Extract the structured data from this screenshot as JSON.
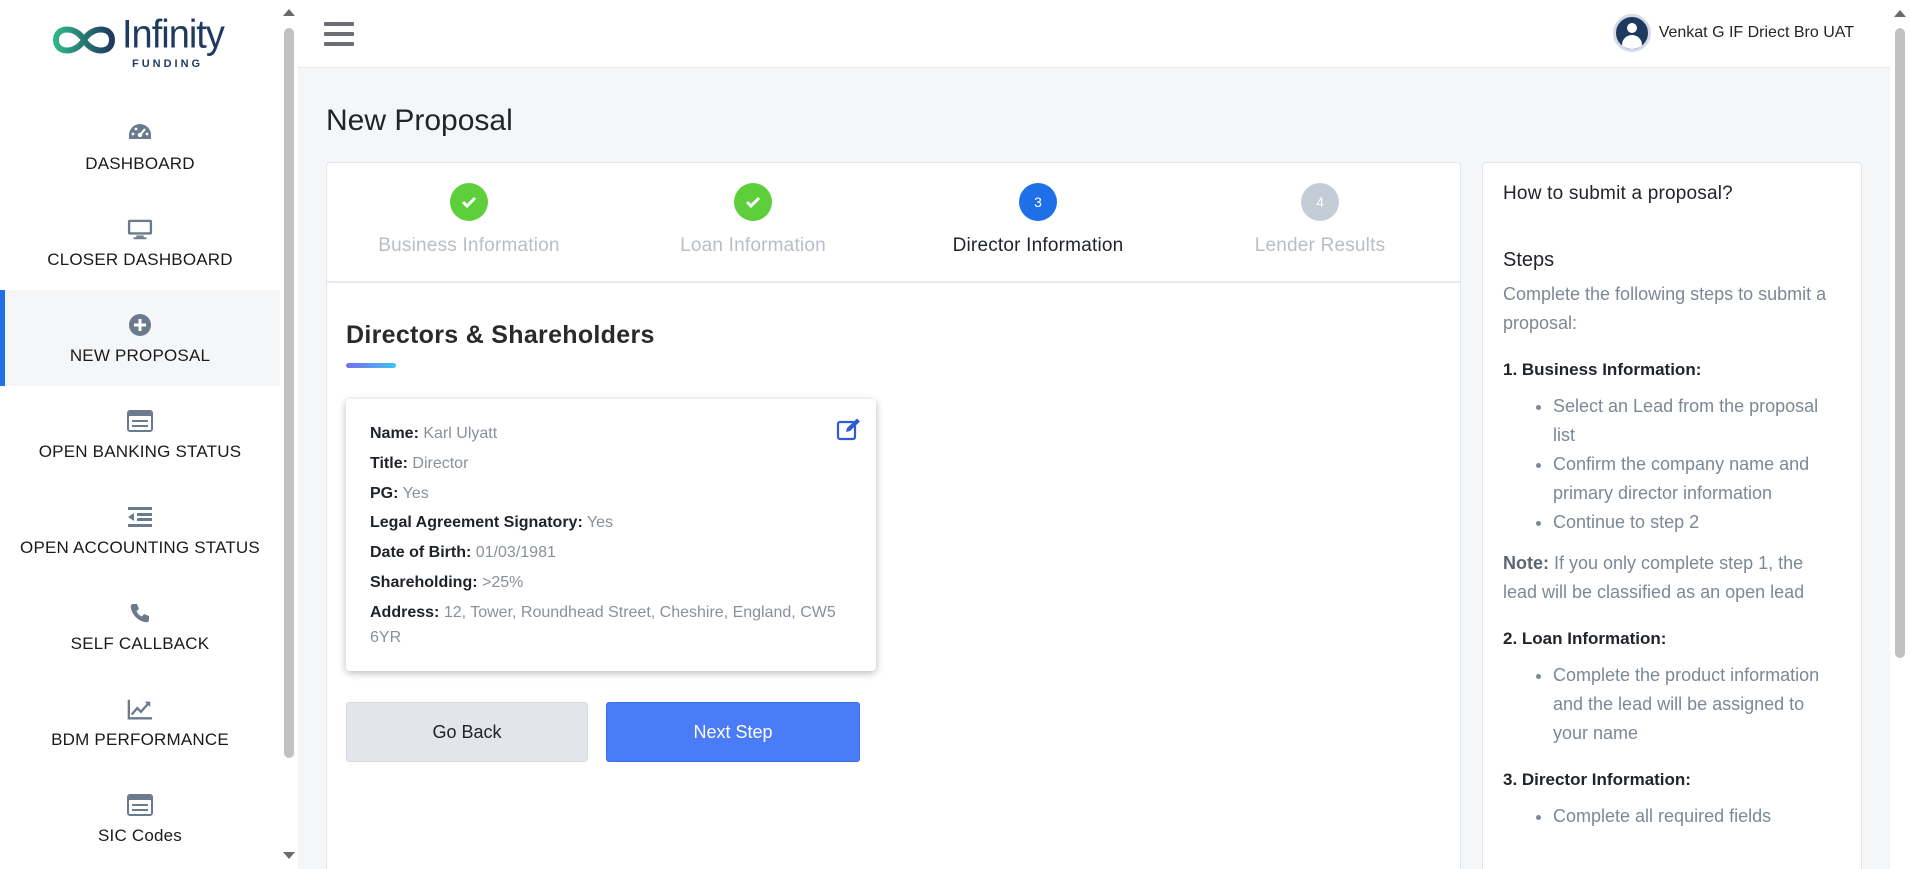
{
  "brand": {
    "name": "Infinity",
    "sub": "FUNDING"
  },
  "sidebar": {
    "items": [
      {
        "label": "DASHBOARD",
        "icon": "dashboard-gauge-icon"
      },
      {
        "label": "CLOSER DASHBOARD",
        "icon": "monitor-icon"
      },
      {
        "label": "NEW PROPOSAL",
        "icon": "plus-circle-icon",
        "active": true
      },
      {
        "label": "OPEN BANKING STATUS",
        "icon": "browser-window-icon"
      },
      {
        "label": "OPEN ACCOUNTING STATUS",
        "icon": "indent-list-icon"
      },
      {
        "label": "SELF CALLBACK",
        "icon": "phone-icon"
      },
      {
        "label": "BDM PERFORMANCE",
        "icon": "line-chart-icon"
      },
      {
        "label": "SIC Codes",
        "icon": "browser-window-icon"
      }
    ]
  },
  "topbar": {
    "user_name": "Venkat G IF Driect Bro UAT"
  },
  "page": {
    "title": "New Proposal"
  },
  "stepper": {
    "steps": [
      {
        "label": "Business Information",
        "state": "done",
        "number": "1"
      },
      {
        "label": "Loan Information",
        "state": "done",
        "number": "2"
      },
      {
        "label": "Director Information",
        "state": "current",
        "number": "3"
      },
      {
        "label": "Lender Results",
        "state": "pending",
        "number": "4"
      }
    ]
  },
  "directors": {
    "title": "Directors & Shareholders",
    "card": {
      "name_label": "Name:",
      "name": "Karl Ulyatt",
      "title_label": "Title:",
      "title": "Director",
      "pg_label": "PG:",
      "pg": "Yes",
      "signatory_label": "Legal Agreement Signatory:",
      "signatory": "Yes",
      "dob_label": "Date of Birth:",
      "dob": "01/03/1981",
      "shareholding_label": "Shareholding:",
      "shareholding": ">25%",
      "address_label": "Address:",
      "address": "12, Tower, Roundhead Street, Cheshire, England, CW5 6YR"
    }
  },
  "buttons": {
    "back": "Go Back",
    "next": "Next Step"
  },
  "help": {
    "title": "How to submit a proposal?",
    "steps_heading": "Steps",
    "intro": "Complete the following steps to submit a proposal:",
    "s1_heading": "1. Business Information:",
    "s1_items": [
      "Select an Lead from the proposal list",
      "Confirm the company name and primary director information",
      "Continue to step 2"
    ],
    "note_label": "Note:",
    "note_text": " If you only complete step 1, the lead will be classified as an open lead",
    "s2_heading": "2. Loan Information:",
    "s2_items": [
      "Complete the product information and the lead will be assigned to your name"
    ],
    "s3_heading": "3. Director Information:",
    "s3_items": [
      "Complete all required fields"
    ]
  },
  "colors": {
    "accent": "#1e6fe8",
    "done": "#5ccf3a",
    "next_button": "#4b7cf7"
  }
}
